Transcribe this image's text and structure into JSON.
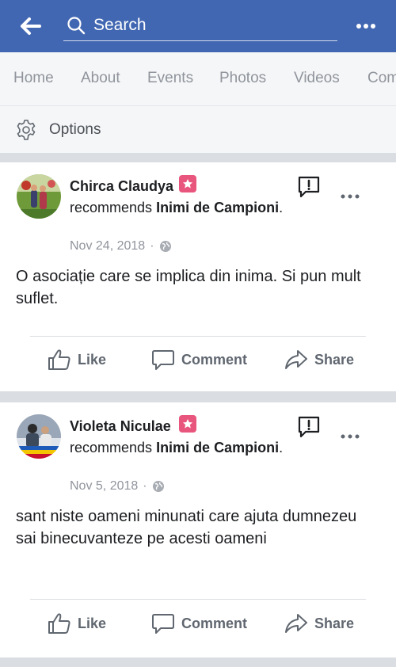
{
  "header": {
    "search_placeholder": "Search",
    "back_icon": "arrow-left-icon",
    "more_icon": "more-dots-icon"
  },
  "tabs": [
    {
      "label": "Home"
    },
    {
      "label": "About"
    },
    {
      "label": "Events"
    },
    {
      "label": "Photos"
    },
    {
      "label": "Videos"
    },
    {
      "label": "Com"
    }
  ],
  "options": {
    "label": "Options",
    "icon": "gear-icon"
  },
  "posts": [
    {
      "author": "Chirca Claudya",
      "recommends_text": "recommends",
      "page_name": "Inimi de Campioni",
      "punct": ".",
      "date": "Nov 24, 2018",
      "sep": "·",
      "privacy_icon": "globe-icon",
      "text": "O asociație care se implica din inima. Si pun mult suflet."
    },
    {
      "author": "Violeta Niculae",
      "recommends_text": "recommends",
      "page_name": "Inimi de Campioni",
      "punct": ".",
      "date": "Nov 5, 2018",
      "sep": "·",
      "privacy_icon": "globe-icon",
      "text": "sant niste oameni minunati care ajuta dumnezeu sai binecuvanteze pe acesti oameni"
    }
  ],
  "actions": {
    "like": "Like",
    "comment": "Comment",
    "share": "Share"
  },
  "colors": {
    "header_bg": "#4267b2",
    "badge": "#e9567d",
    "muted": "#90949c"
  }
}
